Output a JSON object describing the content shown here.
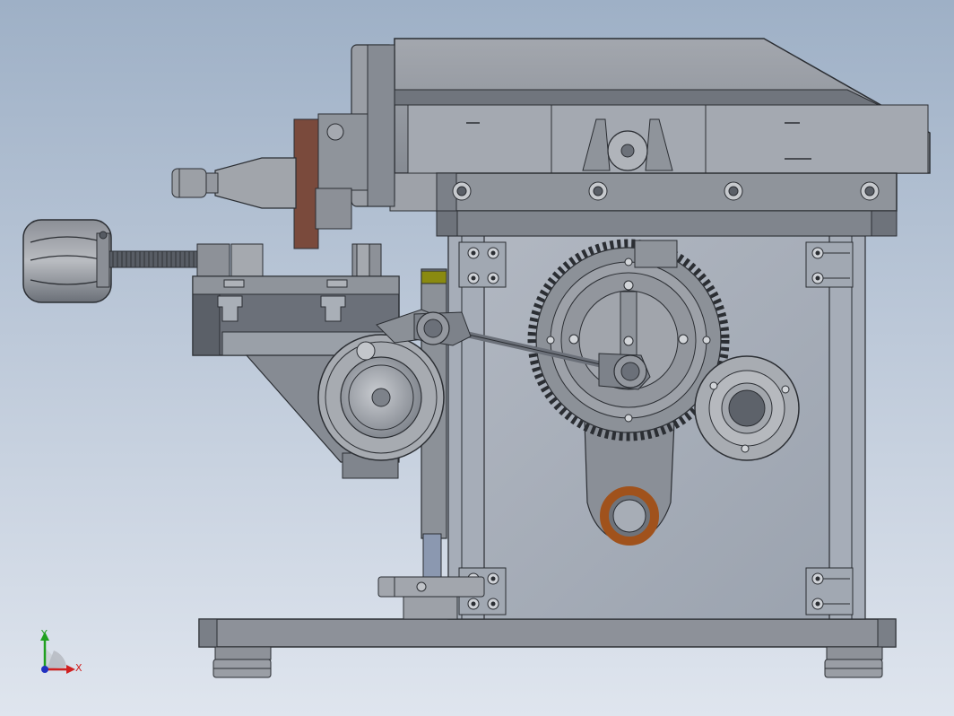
{
  "viewport": {
    "background_top": "#9eb0c6",
    "background_bottom": "#dfe5ee"
  },
  "triad": {
    "x_label": "X",
    "y_label": "Y",
    "x_color": "#d02020",
    "y_color": "#20a020",
    "z_color": "#2030c0"
  },
  "colors": {
    "body_light": "#9da1a8",
    "body_mid": "#7f848c",
    "body_dark": "#5a5f67",
    "panel_fill": "#a9b0bb",
    "brown_part": "#7a4a3c",
    "bronze_ring": "#a0521c",
    "yellow_marker": "#8a8a10"
  }
}
